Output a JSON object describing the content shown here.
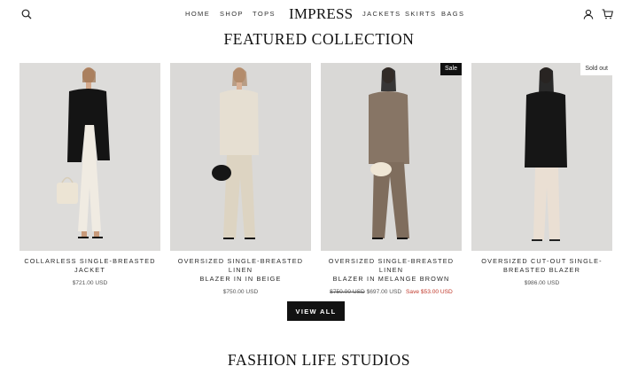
{
  "header": {
    "brand": "IMPRESS",
    "nav_left": [
      "HOME",
      "SHOP",
      "TOPS"
    ],
    "nav_right": [
      "JACKETS",
      "SKIRTS",
      "BAGS"
    ],
    "icons": {
      "search": "search-icon",
      "account": "user-icon",
      "cart": "cart-icon"
    }
  },
  "featured": {
    "title": "FEATURED COLLECTION",
    "products": [
      {
        "title_line1": "COLLARLESS SINGLE-BREASTED",
        "title_line2": "JACKET",
        "price": "$721.00 USD",
        "badge": ""
      },
      {
        "title_line1": "OVERSIZED SINGLE-BREASTED LINEN",
        "title_line2": "BLAZER IN IN BEIGE",
        "price": "$750.00 USD",
        "badge": ""
      },
      {
        "title_line1": "OVERSIZED SINGLE-BREASTED LINEN",
        "title_line2": "BLAZER IN MELANGE BROWN",
        "old_price": "$750.00 USD",
        "price": "$697.00 USD",
        "save": "Save $53.00 USD",
        "badge": "Sale"
      },
      {
        "title_line1": "OVERSIZED CUT-OUT SINGLE-",
        "title_line2": "BREASTED BLAZER",
        "price": "$986.00 USD",
        "badge": "Sold out"
      }
    ],
    "view_all_label": "VIEW ALL"
  },
  "studios": {
    "title": "FASHION LIFE STUDIOS"
  },
  "colors": {
    "background": "#ffffff",
    "button": "#121212",
    "sale_text": "#c0392b",
    "photo_bg": "#d8d7d5"
  }
}
